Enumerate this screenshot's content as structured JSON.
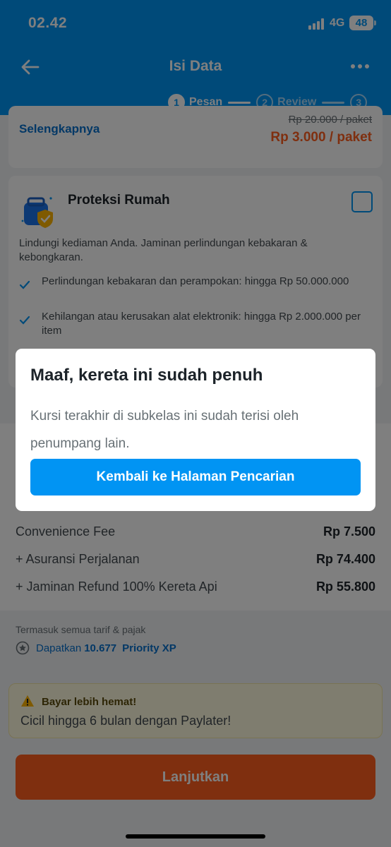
{
  "status_bar": {
    "time": "02.42",
    "network": "4G",
    "battery": "48"
  },
  "header": {
    "title": "Isi Data",
    "steps": [
      {
        "number": "1",
        "label": "Pesan"
      },
      {
        "number": "2",
        "label": "Review"
      },
      {
        "number": "3",
        "label": ""
      }
    ]
  },
  "addon_card": {
    "link": "Selengkapnya",
    "original_price": "Rp 20.000 / paket",
    "price": "Rp 3.000 / paket"
  },
  "protection": {
    "title": "Proteksi Rumah",
    "description": "Lindungi kediaman Anda. Jaminan perlindungan kebakaran & kebongkaran.",
    "benefits": [
      "Perlindungan kebakaran dan perampokan: hingga Rp 50.000.000",
      "Kehilangan atau kerusakan alat elektronik: hingga Rp 2.000.000 per item"
    ]
  },
  "price_breakdown": {
    "rows": [
      {
        "label": "Convenience Fee",
        "value": "Rp 7.500"
      },
      {
        "label": "+ Asuransi Perjalanan",
        "value": "Rp 74.400"
      },
      {
        "label": "+ Jaminan Refund 100% Kereta Api",
        "value": "Rp 55.800"
      }
    ],
    "tax_note": "Termasuk semua tarif & pajak",
    "xp_prefix": "Dapatkan",
    "xp_value": "10.677",
    "xp_suffix": "Priority XP"
  },
  "promo": {
    "title": "Bayar lebih hemat!",
    "text": "Cicil hingga 6 bulan dengan Paylater!"
  },
  "cta": {
    "label": "Lanjutkan"
  },
  "dialog": {
    "title": "Maaf, kereta ini sudah penuh",
    "body": "Kursi terakhir di subkelas ini sudah terisi oleh penumpang lain.",
    "button": "Kembali ke Halaman Pencarian"
  },
  "colors": {
    "primary": "#0194f3",
    "price_accent": "#ff5e1f",
    "link": "#0770cd"
  },
  "icons": [
    "back-arrow-icon",
    "more-icon",
    "house-shield-icon",
    "check-icon",
    "priority-star-icon",
    "warning-icon"
  ]
}
